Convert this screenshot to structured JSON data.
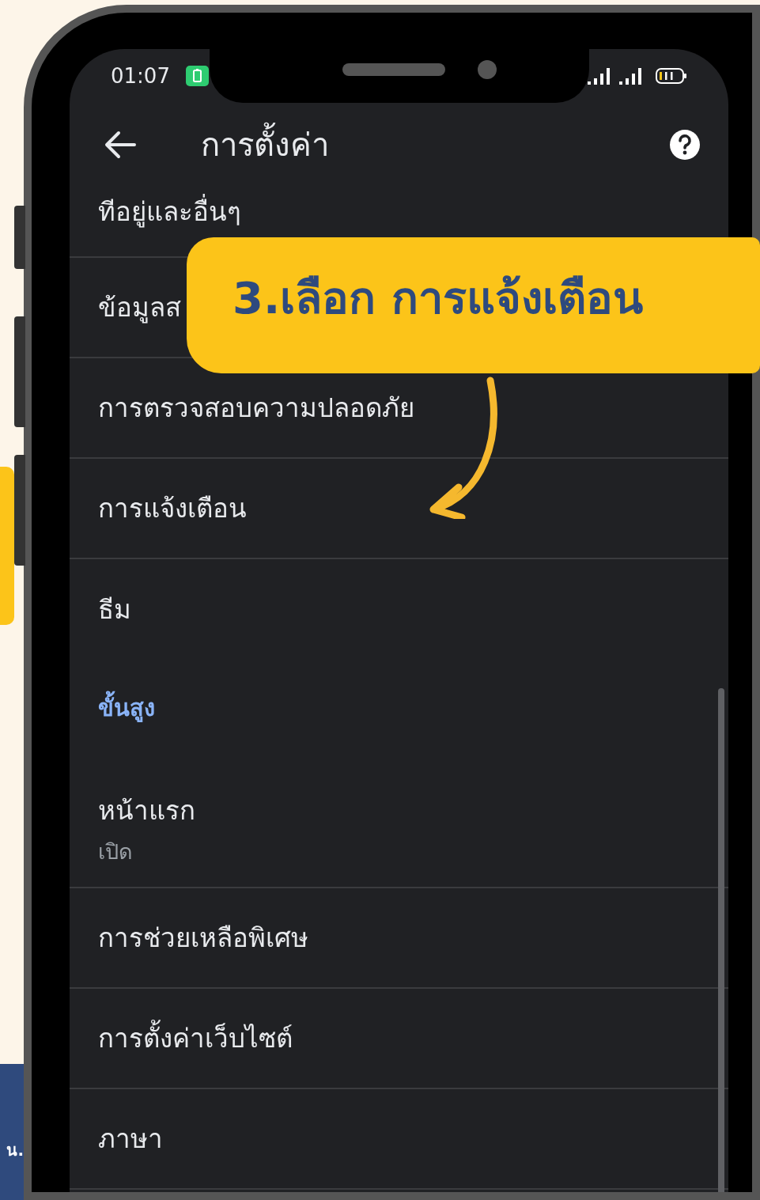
{
  "status_bar": {
    "time": "01:07"
  },
  "app_bar": {
    "title": "การตั้งค่า"
  },
  "items": [
    {
      "kind": "item",
      "title": "ทีอยู่และอื่นๆ"
    },
    {
      "kind": "item",
      "title": "ข้อมูลส"
    },
    {
      "kind": "item",
      "title": "การตรวจสอบความปลอดภัย"
    },
    {
      "kind": "item",
      "title": "การแจ้งเตือน"
    },
    {
      "kind": "item",
      "title": "ธีม"
    },
    {
      "kind": "header",
      "title": "ขั้นสูง"
    },
    {
      "kind": "item",
      "title": "หน้าแรก",
      "subtitle": "เปิด"
    },
    {
      "kind": "item",
      "title": "การช่วยเหลือพิเศษ"
    },
    {
      "kind": "item",
      "title": "การตั้งค่าเว็บไซต์"
    },
    {
      "kind": "item",
      "title": "ภาษา"
    }
  ],
  "callout": {
    "text": "3.เลือก การแจ้งเตือน"
  },
  "side_label": {
    "text": "น."
  }
}
